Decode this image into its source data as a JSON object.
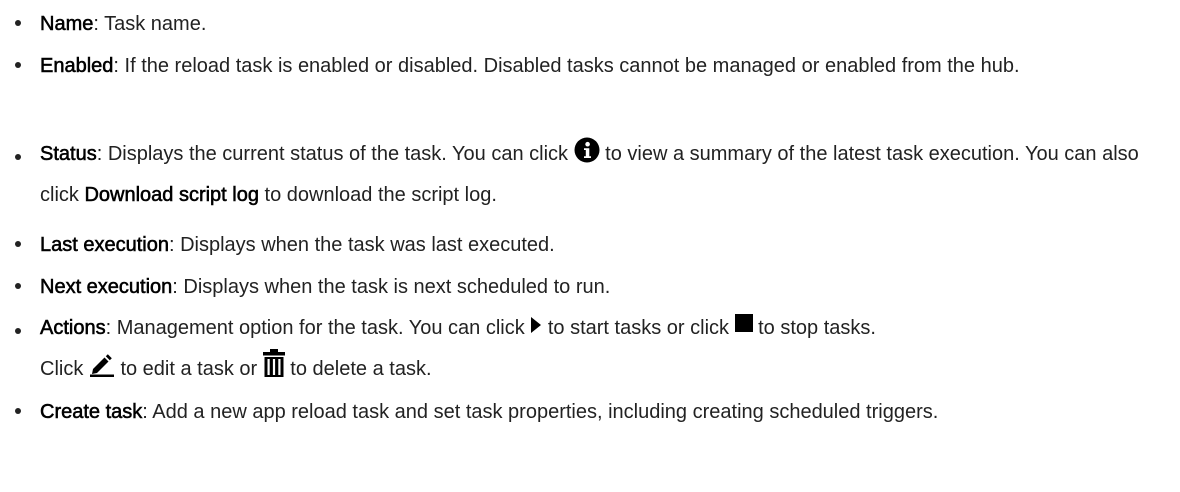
{
  "items": [
    {
      "term": "Name",
      "desc": ": Task name."
    },
    {
      "term": "Enabled",
      "desc": ": If the reload task is enabled or disabled. Disabled tasks cannot be managed or enabled from the hub."
    },
    {
      "term": "Status",
      "desc_1": ": Displays the current status of the task. You can click ",
      "icon_1": "info-circle-icon",
      "desc_2": " to view a summary of the latest task execution. You can also click ",
      "strong": "Download script log",
      "desc_3": " to download the script log."
    },
    {
      "term": "Last execution",
      "desc": ": Displays when the task was last executed."
    },
    {
      "term": "Next execution",
      "desc": ": Displays when the task is next scheduled to run."
    },
    {
      "term": "Actions",
      "desc_1": ": Management option for the task. You can click ",
      "icon_1": "play-icon",
      "desc_2": " to start tasks or click ",
      "icon_2": "stop-icon",
      "desc_3": " to stop tasks.",
      "desc_4": "Click ",
      "icon_3": "edit-pencil-icon",
      "desc_5": " to edit a task or ",
      "icon_4": "trash-icon",
      "desc_6": " to delete a task."
    },
    {
      "term": "Create task",
      "desc": ": Add a new app reload task and set task properties, including creating scheduled triggers."
    }
  ],
  "colors": {
    "text": "#222222",
    "term": "#000000"
  }
}
